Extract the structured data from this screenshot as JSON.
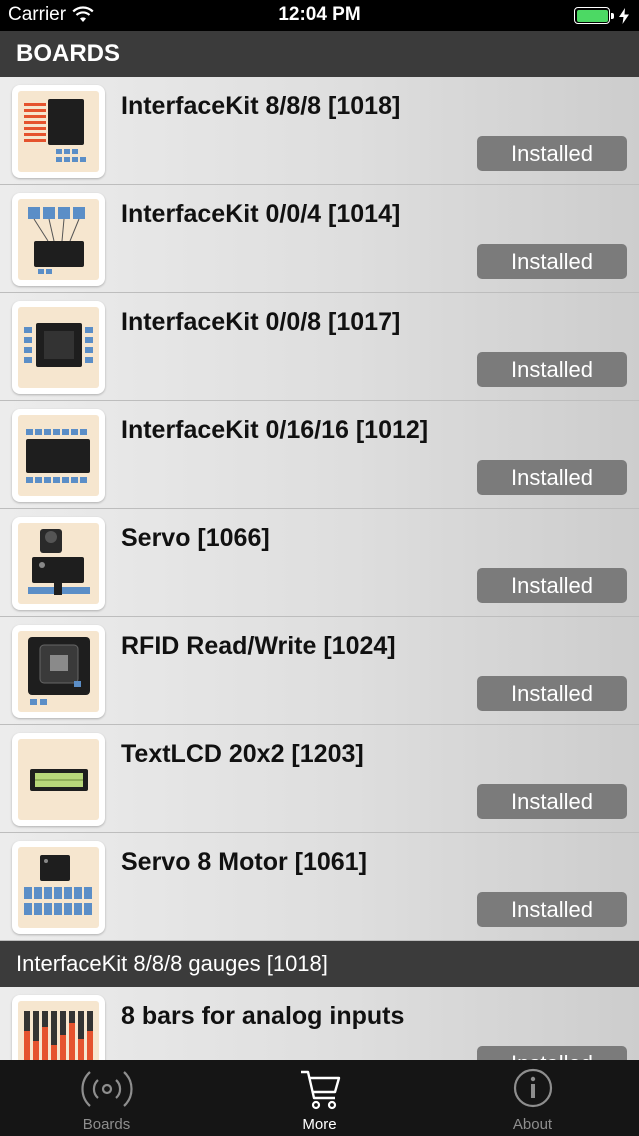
{
  "status_bar": {
    "carrier": "Carrier",
    "time": "12:04 PM",
    "wifi_icon": "wifi-icon",
    "battery_icon": "battery-charging-icon",
    "battery_color": "#4cd964"
  },
  "sections": {
    "boards_header": "BOARDS",
    "gauges_header": "InterfaceKit 8/8/8 gauges [1018]"
  },
  "boards": [
    {
      "title": "InterfaceKit 8/8/8 [1018]",
      "button": "Installed"
    },
    {
      "title": "InterfaceKit 0/0/4 [1014]",
      "button": "Installed"
    },
    {
      "title": "InterfaceKit 0/0/8 [1017]",
      "button": "Installed"
    },
    {
      "title": "InterfaceKit 0/16/16 [1012]",
      "button": "Installed"
    },
    {
      "title": "Servo [1066]",
      "button": "Installed"
    },
    {
      "title": "RFID Read/Write [1024]",
      "button": "Installed"
    },
    {
      "title": "TextLCD 20x2 [1203]",
      "button": "Installed"
    },
    {
      "title": "Servo 8 Motor [1061]",
      "button": "Installed"
    }
  ],
  "gauges": [
    {
      "title": "8 bars for analog inputs",
      "button": "Installed"
    }
  ],
  "tab_bar": {
    "tabs": [
      {
        "label": "Boards",
        "icon": "broadcast-icon",
        "active": false
      },
      {
        "label": "More",
        "icon": "cart-icon",
        "active": true
      },
      {
        "label": "About",
        "icon": "info-icon",
        "active": false
      }
    ],
    "active_color": "#ffffff",
    "inactive_color": "#8e8e8e"
  },
  "colors": {
    "header_bg": "#3b3b3b",
    "button_bg": "#7b7b7b",
    "thumb_bg": "#f6e6cf"
  }
}
